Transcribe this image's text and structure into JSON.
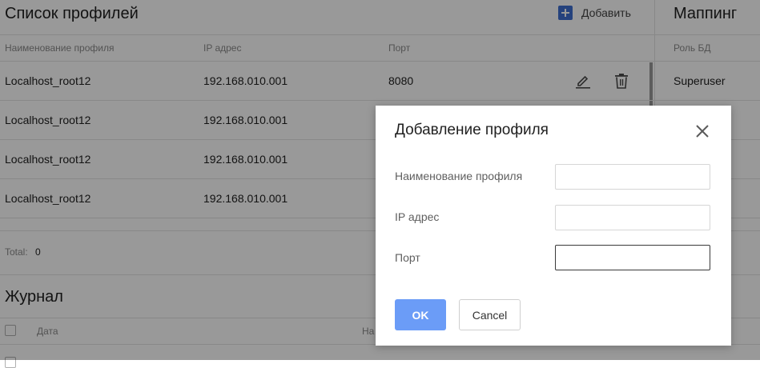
{
  "profiles": {
    "title": "Список профилей",
    "add_label": "Добавить",
    "columns": {
      "name": "Наименование профиля",
      "ip": "IP адрес",
      "port": "Порт"
    },
    "rows": [
      {
        "name": "Localhost_root12",
        "ip": "192.168.010.001",
        "port": "8080"
      },
      {
        "name": "Localhost_root12",
        "ip": "192.168.010.001",
        "port": ""
      },
      {
        "name": "Localhost_root12",
        "ip": "192.168.010.001",
        "port": ""
      },
      {
        "name": "Localhost_root12",
        "ip": "192.168.010.001",
        "port": ""
      }
    ],
    "total_label": "Total:",
    "total_value": "0"
  },
  "mapping": {
    "title": "Маппинг",
    "column_role": "Роль БД",
    "rows": [
      {
        "role": "Superuser"
      }
    ]
  },
  "journal": {
    "title": "Журнал",
    "column_date": "Дата",
    "column_partial": "На"
  },
  "dialog": {
    "title": "Добавление профиля",
    "fields": {
      "name_label": "Наименование профиля",
      "name_value": "",
      "ip_label": "IP адрес",
      "ip_value": "",
      "port_label": "Порт",
      "port_value": ""
    },
    "ok_label": "OK",
    "cancel_label": "Cancel"
  },
  "colors": {
    "accent": "#6b9cf7",
    "add_icon": "#3f6fd1",
    "overlay": "rgba(0,0,0,0.40)"
  },
  "icons": [
    "add-box-icon",
    "edit-pencil-icon",
    "trash-icon",
    "close-icon"
  ]
}
